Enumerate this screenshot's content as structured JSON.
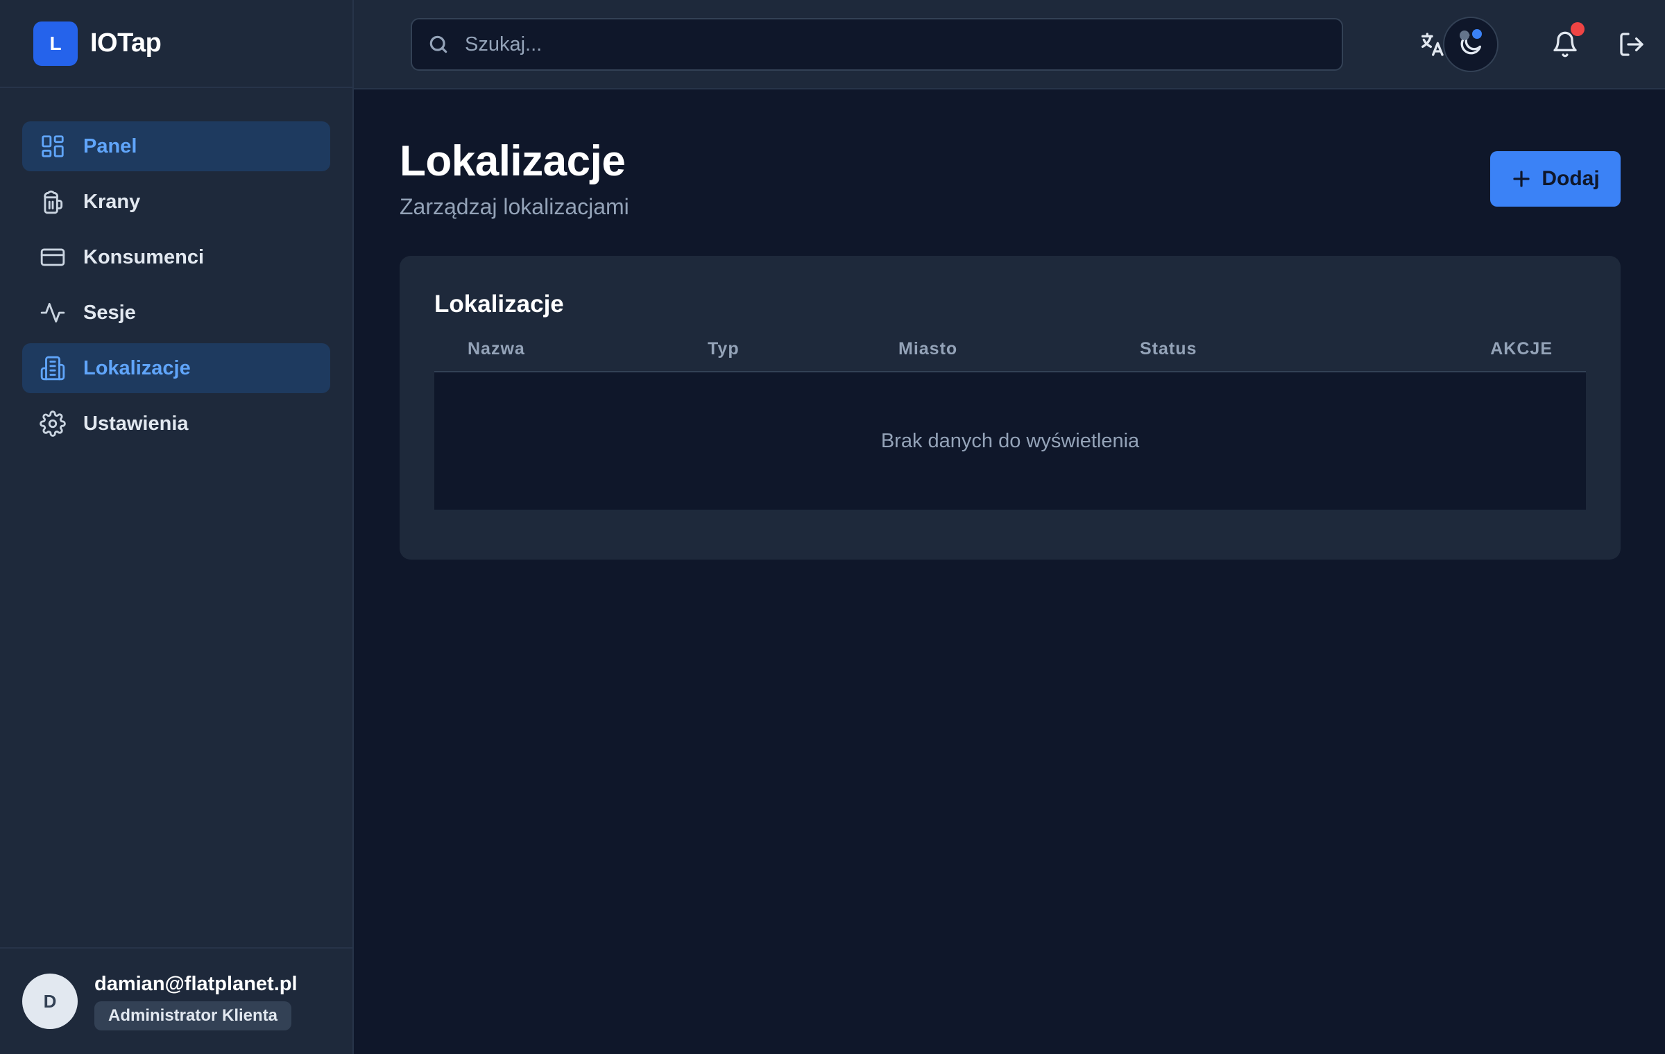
{
  "brand": {
    "logo_letter": "L",
    "name": "IOTap"
  },
  "sidebar": {
    "items": [
      {
        "label": "Panel",
        "icon": "grid-icon",
        "active": true
      },
      {
        "label": "Krany",
        "icon": "beer-mug-icon",
        "active": false
      },
      {
        "label": "Konsumenci",
        "icon": "card-icon",
        "active": false
      },
      {
        "label": "Sesje",
        "icon": "activity-icon",
        "active": false
      },
      {
        "label": "Lokalizacje",
        "icon": "building-icon",
        "active": true
      },
      {
        "label": "Ustawienia",
        "icon": "gear-icon",
        "active": false
      }
    ]
  },
  "user": {
    "initial": "D",
    "email": "damian@flatplanet.pl",
    "role": "Administrator Klienta"
  },
  "header": {
    "search_placeholder": "Szukaj...",
    "icons": [
      "translate-icon",
      "theme-toggle-icon",
      "bell-icon",
      "logout-icon"
    ]
  },
  "page": {
    "title": "Lokalizacje",
    "subtitle": "Zarządzaj lokalizacjami",
    "add_label": "Dodaj"
  },
  "table": {
    "title": "Lokalizacje",
    "columns": [
      "Nazwa",
      "Typ",
      "Miasto",
      "Status",
      "AKCJE"
    ],
    "empty_text": "Brak danych do wyświetlenia"
  },
  "colors": {
    "accent": "#3b82f6",
    "notification_dot": "#ef4444",
    "background": "#0f172a",
    "panel": "#1e293b"
  }
}
